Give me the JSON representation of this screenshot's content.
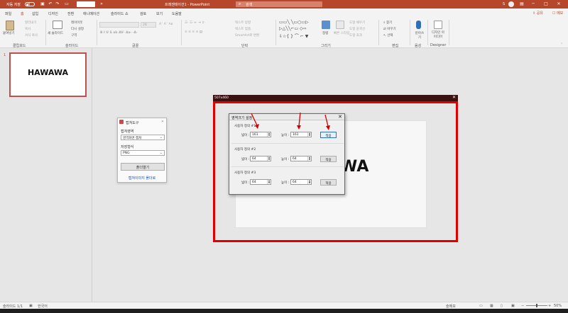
{
  "titlebar": {
    "autosave": "자동 저장",
    "autosave_state": "끔",
    "doc_title": "프레젠테이션1 - PowerPoint",
    "search_placeholder": "검색",
    "user_initial": "S"
  },
  "tabs": [
    "파일",
    "홈",
    "삽입",
    "디자인",
    "전환",
    "애니메이션",
    "슬라이드 쇼",
    "검토",
    "보기",
    "도움말"
  ],
  "active_tab": "홈",
  "share_label": "공유",
  "comment_label": "메모",
  "ribbon": {
    "clipboard": {
      "paste": "붙여넣기",
      "cut": "잘라내기",
      "copy": "복사",
      "format_painter": "서식 복사",
      "label": "클립보드"
    },
    "slides": {
      "new_slide": "새 슬라이드",
      "layout": "레이아웃",
      "reset": "다시 설정",
      "section": "구역",
      "label": "슬라이드"
    },
    "font": {
      "label": "글꼴",
      "size": "28"
    },
    "paragraph": {
      "label": "단락",
      "text_direction": "텍스트 방향",
      "align_text": "텍스트 맞춤",
      "smartart": "SmartArt로 변환"
    },
    "drawing": {
      "arrange": "정렬",
      "quick_styles": "빠른 스타일",
      "fill": "도형 채우기",
      "outline": "도형 윤곽선",
      "effects": "도형 효과",
      "label": "그리기"
    },
    "editing": {
      "find": "찾기",
      "replace": "바꾸기",
      "select": "선택",
      "label": "편집"
    },
    "voice": {
      "dictate": "받아쓰기",
      "label": "음성"
    },
    "designer": {
      "ideas": "디자인 아이디어",
      "label": "Designer"
    }
  },
  "slide_panel": {
    "slide_number": "1",
    "thumb_text": "HAWAWA"
  },
  "slide_main_text": "AWA",
  "statusbar": {
    "slide_info": "슬라이드 1/1",
    "language": "한국어",
    "notes": "슬메모",
    "zoom": "50%"
  },
  "capture_tool": {
    "title": "캡쳐도구",
    "region_label": "캡쳐영역",
    "region_value": "영역화면 캡쳐",
    "format_label": "저장형식",
    "format_value": "PNG",
    "capture_button": "폴더열기",
    "open_folder_link": "캡쳐이미지 폴더로"
  },
  "region_window": {
    "title": "507x460"
  },
  "size_dialog": {
    "title": "영역크기 설정",
    "groups": [
      {
        "label": "사용자 정의 #1",
        "width_label": "넓이 :",
        "width": "161",
        "height_label": "높이 :",
        "height": "161",
        "apply": "적용"
      },
      {
        "label": "사용자 정의 #2",
        "width_label": "넓이 :",
        "width": "64",
        "height_label": "높이 :",
        "height": "64",
        "apply": "적용"
      },
      {
        "label": "사용자 정의 #3",
        "width_label": "넓이 :",
        "width": "64",
        "height_label": "높이 :",
        "height": "64",
        "apply": "적용"
      }
    ]
  },
  "colors": {
    "accent": "#b7472a",
    "frame": "#e00000",
    "arrow": "#d00000"
  }
}
